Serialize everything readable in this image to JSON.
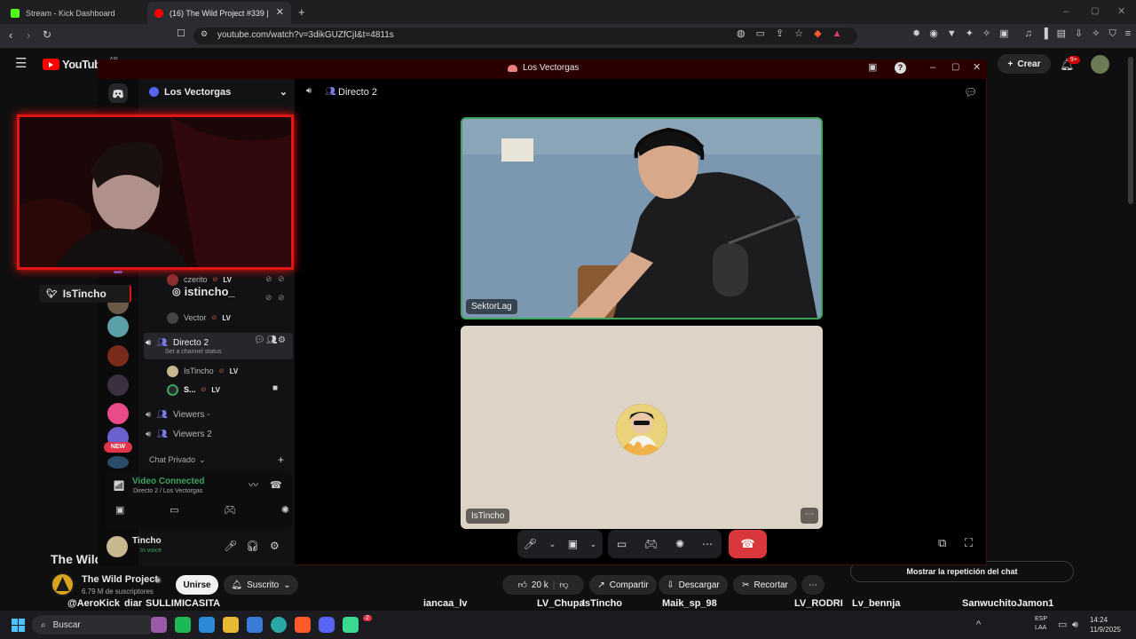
{
  "browser": {
    "tabs": [
      {
        "title": "Stream - Kick Dashboard",
        "color": "#53fc18"
      },
      {
        "title": "(16) The Wild Project #339 | Stre",
        "color": "#ff0000"
      }
    ],
    "url": "youtube.com/watch?v=3dikGUZfCjI&t=4811s"
  },
  "youtube": {
    "logo": "YouTube",
    "country": "AR",
    "create_label": "Crear",
    "notif_count": "9+",
    "video_title": "The Wild",
    "channel_name": "The Wild Project",
    "subscribers": "6.79 M de suscriptores",
    "join_label": "Unirse",
    "subscribed_label": "Suscrito",
    "likes": "20 k",
    "share_label": "Compartir",
    "download_label": "Descargar",
    "clip_label": "Recortar",
    "chat_replay_label": "Mostrar la repetición del chat"
  },
  "discord": {
    "window_title": "Los Vectorgas",
    "server_name": "Los Vectorgas",
    "current_channel": "Directo 2",
    "new_badge": "NEW",
    "members_above": [
      {
        "name": "czerito",
        "badge": "LV"
      },
      {
        "name": "Vector",
        "badge": "LV"
      }
    ],
    "channel": {
      "name": "Directo 2",
      "status": "Set a channel status"
    },
    "members": [
      {
        "name": "IsTincho",
        "badge": "LV"
      },
      {
        "name": "S...",
        "badge": "LV"
      }
    ],
    "voice_channels": [
      "Viewers -",
      "Viewers 2"
    ],
    "private_chat": "Chat Privado",
    "connection": {
      "status": "Video Connected",
      "location": "Directo 2 / Los Vectorgas"
    },
    "user": {
      "name": "Tincho",
      "status": "In voice"
    },
    "tiles": [
      {
        "name": "SektorLag"
      },
      {
        "name": "IsTincho"
      }
    ]
  },
  "overlay": {
    "twitter": "IsTincho",
    "instagram": "istincho_"
  },
  "chat_names": [
    "@AeroKick",
    "diar",
    "SULLIMICASITA",
    "iancaa_lv",
    "LV_Chupa",
    "IsTincho",
    "Maik_sp_98",
    "LV_RODRI",
    "Lv_bennja",
    "SanwuchitoJamon1"
  ],
  "taskbar": {
    "search_label": "Buscar",
    "lang": "ESP",
    "lang2": "LAA",
    "time": "14:24",
    "date": "11/9/2025",
    "discord_badge": "2"
  }
}
